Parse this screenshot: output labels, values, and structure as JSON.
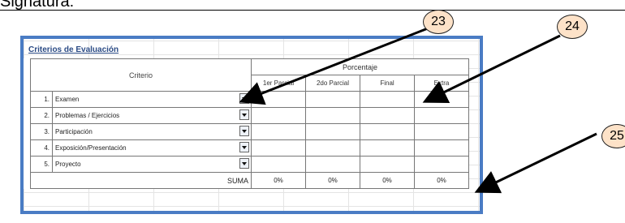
{
  "heading": "Signatura:",
  "section_title": "Criterios de Evaluación",
  "table": {
    "criterio_header": "Criterio",
    "porcentaje_header": "Porcentaje",
    "sub_headers": [
      "1er Parcial",
      "2do Parcial",
      "Final",
      "Extra"
    ],
    "rows": [
      {
        "num": "1.",
        "name": "Examen"
      },
      {
        "num": "2.",
        "name": "Problemas / Ejercicios"
      },
      {
        "num": "3.",
        "name": "Participación"
      },
      {
        "num": "4.",
        "name": "Exposición/Presentación"
      },
      {
        "num": "5.",
        "name": "Proyecto"
      }
    ],
    "suma_label": "SUMA",
    "suma_values": [
      "0%",
      "0%",
      "0%",
      "0%"
    ]
  },
  "callouts": [
    "23",
    "24",
    "25"
  ],
  "colors": {
    "frame": "#4a7cc4",
    "callout_fill": "#fde2c8",
    "title": "#2b4b85"
  }
}
